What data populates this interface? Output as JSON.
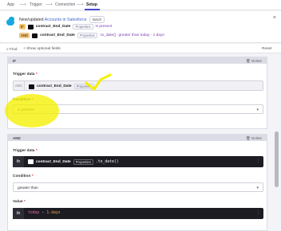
{
  "breadcrumb": {
    "items": [
      "App",
      "Trigger",
      "Connection",
      "Setup"
    ],
    "active_index": 3
  },
  "header": {
    "title_prefix": "New/updated",
    "title_object": "Accounts in Salesforce",
    "batch_label": "Batch",
    "condition_if": {
      "tag": "IF",
      "field": "contract_End_Date",
      "properties": "Properties",
      "operator": "is present"
    },
    "condition_and": {
      "tag": "AND",
      "field": "contract_End_Date",
      "properties": "Properties",
      "method": ".to_date()",
      "operator": "greater than today - 1.days"
    },
    "close_icon": "close-icon"
  },
  "toolbar": {
    "find_label": "Find",
    "show_optional_label": "Show optional fields",
    "reset_label": "Reset"
  },
  "if_block": {
    "label": "IF",
    "delete_label": "Delete",
    "trigger_data_label": "Trigger data",
    "required_mark": "*",
    "fx_label": "ABC",
    "field": "contract_End_Date",
    "properties": "Properties",
    "condition_label": "Condition",
    "condition_value": "is present"
  },
  "and_block": {
    "label": "AND",
    "delete_label": "Delete",
    "trigger_data_label": "Trigger data",
    "required_mark": "*",
    "fx_label": "fx",
    "field": "contract_End_Date",
    "properties": "Properties",
    "method": ".to_date()",
    "condition_label": "Condition",
    "condition_value": "greater than",
    "value_label": "Value",
    "value_fx": "fx",
    "value_expr_a": "today",
    "value_expr_op": "-",
    "value_expr_b": "1.days"
  },
  "colors": {
    "accent": "#4a4ad0",
    "highlight": "#f5f000",
    "if_tag": "#f3c66b",
    "dark_field": "#1c1c22"
  }
}
